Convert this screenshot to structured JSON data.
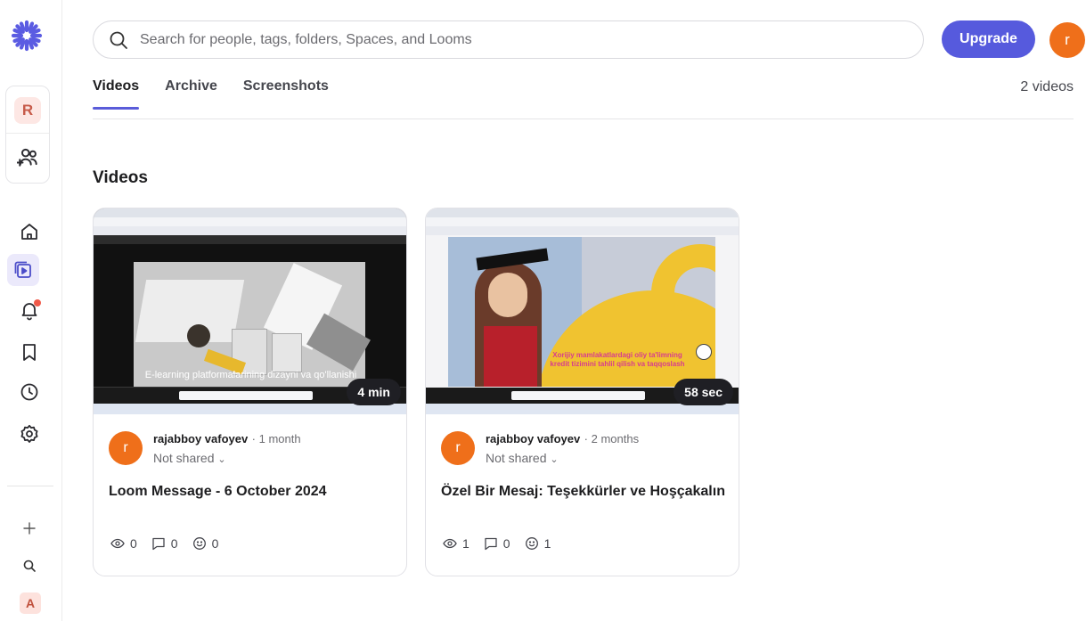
{
  "sidebar": {
    "workspace_initial": "R",
    "account_initial": "A",
    "icons": [
      "loom-logo-icon",
      "people-add-icon",
      "home-icon",
      "library-icon",
      "bell-icon",
      "bookmark-icon",
      "clock-icon",
      "gear-icon",
      "plus-icon",
      "search-icon"
    ],
    "active_item": "library"
  },
  "search": {
    "placeholder": "Search for people, tags, folders, Spaces, and Looms"
  },
  "header": {
    "upgrade_label": "Upgrade",
    "avatar_initial": "r"
  },
  "tabs": [
    {
      "label": "Videos",
      "active": true
    },
    {
      "label": "Archive",
      "active": false
    },
    {
      "label": "Screenshots",
      "active": false
    }
  ],
  "video_count": "2 videos",
  "section_title": "Videos",
  "videos": [
    {
      "duration": "4 min",
      "thumbnail_caption": "E-learning platformalarining dizayni va qo'llanishi",
      "author_initial": "r",
      "author": "rajabboy vafoyev",
      "ago": "· 1 month",
      "sharing": "Not shared",
      "title": "Loom Message - 6 October 2024",
      "views": "0",
      "comments": "0",
      "reactions": "0"
    },
    {
      "duration": "58 sec",
      "thumbnail_caption": "Xorijiy mamlakatlardagi oliy ta'limning kredit tizimini tahlil qilish va taqqoslash",
      "author_initial": "r",
      "author": "rajabboy vafoyev",
      "ago": "· 2 months",
      "sharing": "Not shared",
      "title": "Özel Bir Mesaj: Teşekkürler ve Hoşçakalın",
      "views": "1",
      "comments": "0",
      "reactions": "1"
    }
  ],
  "colors": {
    "accent": "#565add",
    "avatar": "#ef6f1a",
    "notification": "#f05a4a"
  }
}
